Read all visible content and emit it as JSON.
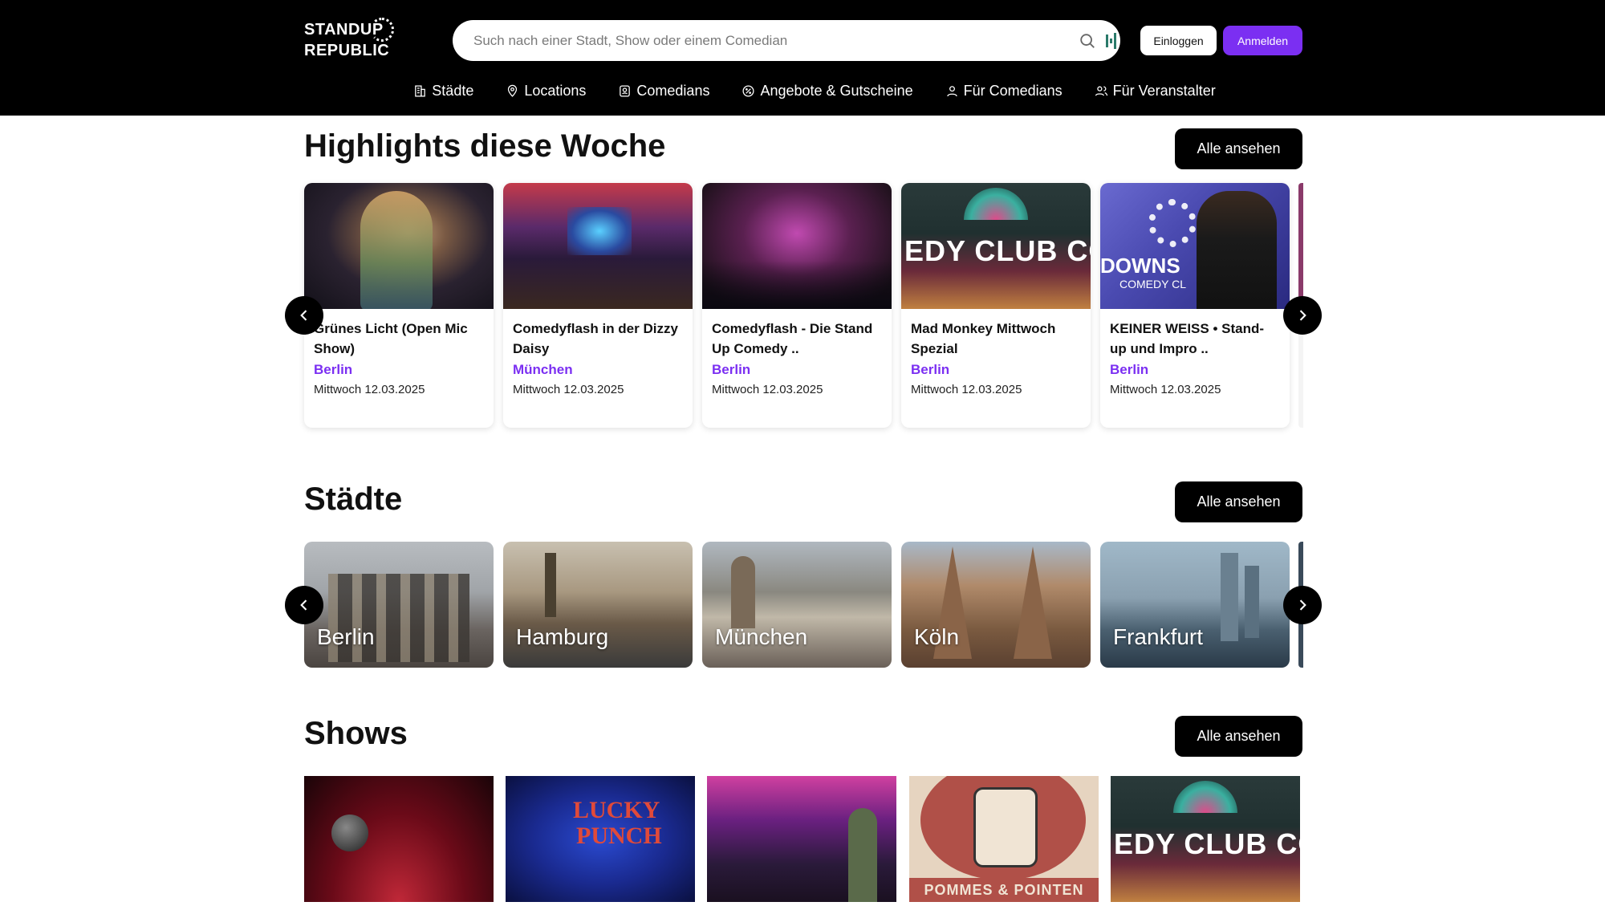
{
  "header": {
    "logo_line1": "STANDUP",
    "logo_line2": "REPUBLIC",
    "search_placeholder": "Such nach einer Stadt, Show oder einem Comedian",
    "login_label": "Einloggen",
    "signup_label": "Anmelden",
    "accent_color": "#7b2ff2"
  },
  "nav": [
    {
      "label": "Städte",
      "icon": "city-icon"
    },
    {
      "label": "Locations",
      "icon": "location-pin-icon"
    },
    {
      "label": "Comedians",
      "icon": "comedian-icon"
    },
    {
      "label": "Angebote & Gutscheine",
      "icon": "badge-percent-icon"
    },
    {
      "label": "Für Comedians",
      "icon": "user-icon"
    },
    {
      "label": "Für Veranstalter",
      "icon": "users-icon"
    }
  ],
  "highlights": {
    "title": "Highlights diese Woche",
    "all_label": "Alle ansehen",
    "cards": [
      {
        "title": "Grünes Licht (Open Mic Show)",
        "city": "Berlin",
        "date": "Mittwoch 12.03.2025"
      },
      {
        "title": "Comedyflash in der Dizzy Daisy",
        "city": "München",
        "date": "Mittwoch 12.03.2025"
      },
      {
        "title": "Comedyflash - Die Stand Up Comedy ..",
        "city": "Berlin",
        "date": "Mittwoch 12.03.2025"
      },
      {
        "title": "Mad Monkey Mittwoch Spezial",
        "city": "Berlin",
        "date": "Mittwoch 12.03.2025"
      },
      {
        "title": "KEINER WEISS • Stand-up und Impro ..",
        "city": "Berlin",
        "date": "Mittwoch 12.03.2025"
      }
    ]
  },
  "cities": {
    "title": "Städte",
    "all_label": "Alle ansehen",
    "items": [
      "Berlin",
      "Hamburg",
      "München",
      "Köln",
      "Frankfurt"
    ]
  },
  "shows": {
    "title": "Shows",
    "all_label": "Alle ansehen",
    "image_texts": {
      "lucky_punch_1": "LUCKY",
      "lucky_punch_2": "PUNCH",
      "pommes": "POMMES & POINTEN",
      "club": "EDY CLUB CON"
    }
  },
  "image_texts": {
    "club": "EDY CLUB CON",
    "downs": "DOWNS",
    "downs_sub": "COMEDY CL"
  }
}
